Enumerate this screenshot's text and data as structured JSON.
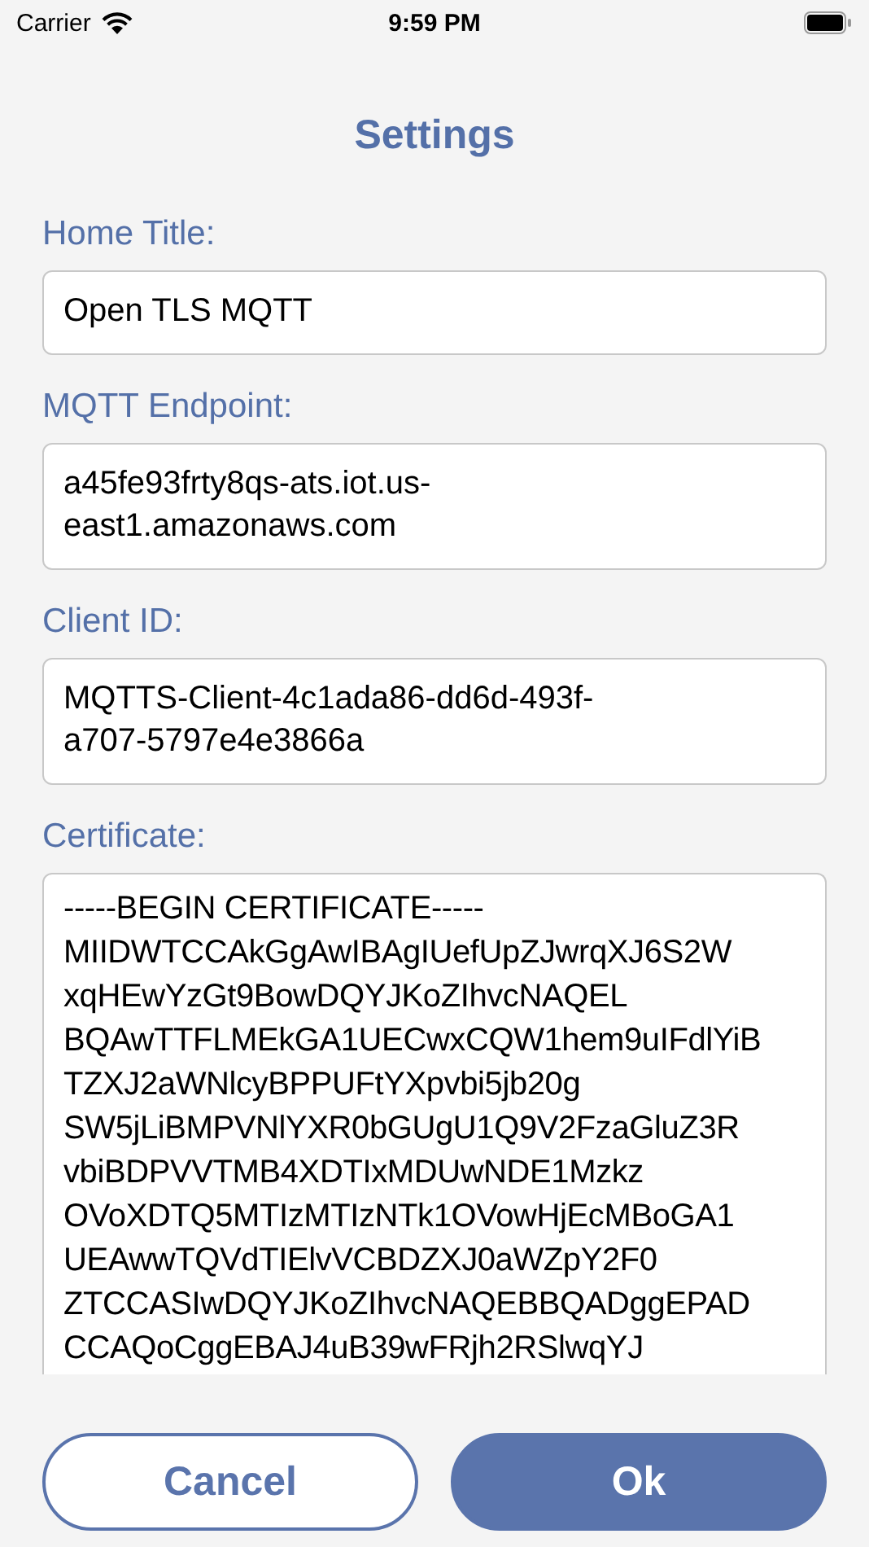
{
  "status_bar": {
    "carrier": "Carrier",
    "time": "9:59 PM"
  },
  "title": "Settings",
  "fields": [
    {
      "label": "Home Title:",
      "lines": [
        "Open TLS MQTT"
      ]
    },
    {
      "label": "MQTT Endpoint:",
      "lines": [
        "a45fe93frty8qs-ats.iot.us-",
        "east1.amazonaws.com"
      ]
    },
    {
      "label": "Client ID:",
      "lines": [
        "MQTTS-Client-4c1ada86-dd6d-493f-",
        "a707-5797e4e3866a"
      ]
    }
  ],
  "certificate": {
    "label": "Certificate:",
    "lines": [
      "-----BEGIN CERTIFICATE-----",
      "MIIDWTCCAkGgAwIBAgIUefUpZJwrqXJ6S2W",
      "xqHEwYzGt9BowDQYJKoZIhvcNAQEL",
      "BQAwTTFLMEkGA1UECwxCQW1hem9uIFdlYiB",
      "TZXJ2aWNlcyBPPUFtYXpvbi5jb20g",
      "SW5jLiBMPVNlYXR0bGUgU1Q9V2FzaGluZ3R",
      "vbiBDPVVTMB4XDTIxMDUwNDE1Mzkz",
      "OVoXDTQ5MTIzMTIzNTk1OVowHjEcMBoGA1",
      "UEAwwTQVdTIElvVCBDZXJ0aWZpY2F0",
      "ZTCCASIwDQYJKoZIhvcNAQEBBQADggEPAD",
      "CCAQoCggEBAJ4uB39wFRjh2RSlwqYJ"
    ]
  },
  "buttons": [
    {
      "label": "Cancel",
      "kind": "outline"
    },
    {
      "label": "Ok",
      "kind": "filled"
    }
  ]
}
